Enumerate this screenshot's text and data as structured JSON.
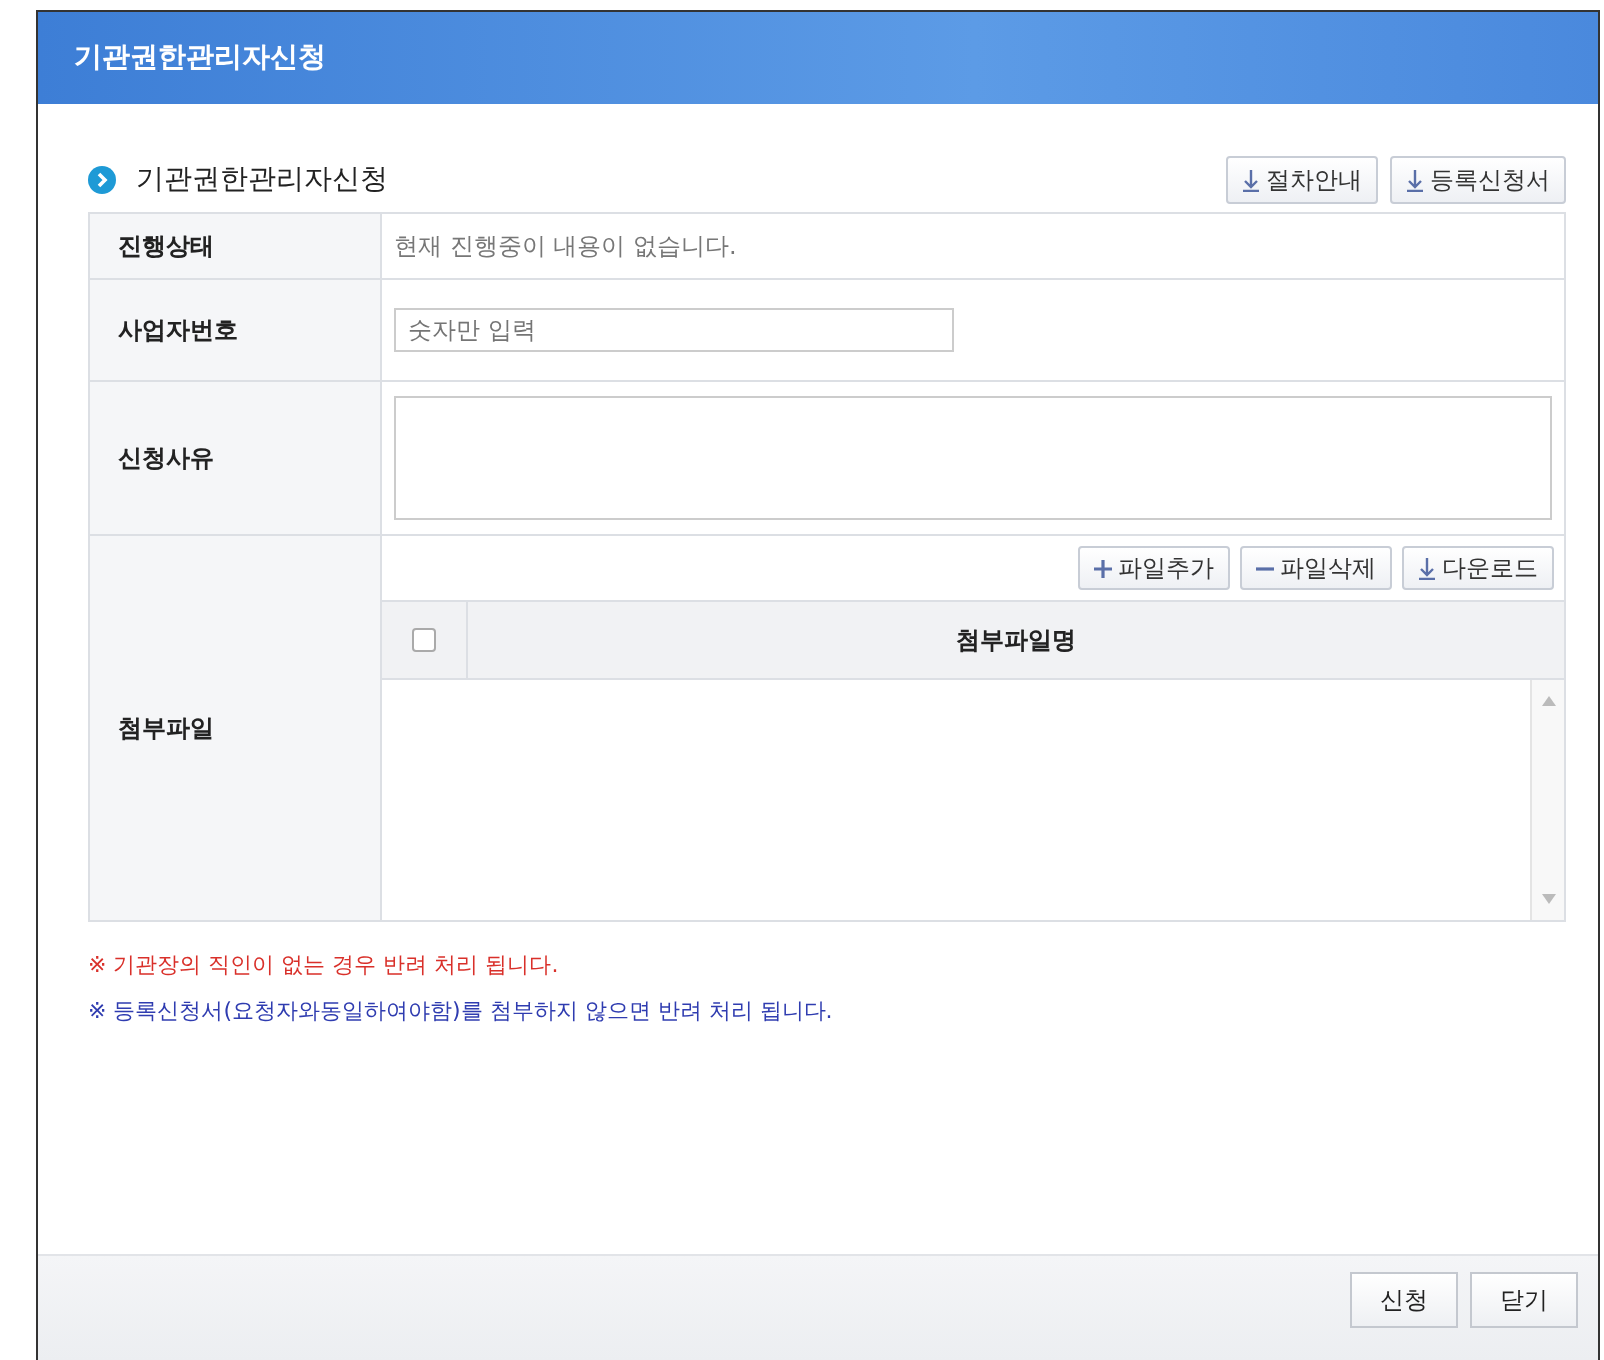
{
  "window": {
    "title": "기관권한관리자신청"
  },
  "section": {
    "title": "기관권한관리자신청",
    "buttons": [
      {
        "label": "절차안내",
        "kind": "download"
      },
      {
        "label": "등록신청서",
        "kind": "download"
      }
    ]
  },
  "form": {
    "status": {
      "label": "진행상태",
      "value": "현재 진행중이 내용이 없습니다."
    },
    "business_number": {
      "label": "사업자번호",
      "placeholder": "숫자만 입력"
    },
    "reason": {
      "label": "신청사유"
    },
    "attachments": {
      "label": "첨부파일",
      "buttons": [
        {
          "label": "파일추가",
          "kind": "add"
        },
        {
          "label": "파일삭제",
          "kind": "remove"
        },
        {
          "label": "다운로드",
          "kind": "download"
        }
      ],
      "select_all_checked": false,
      "column": "첨부파일명"
    }
  },
  "notes": [
    {
      "text": "※ 기관장의 직인이 없는 경우 반려 처리 됩니다.",
      "color": "#d9302a"
    },
    {
      "text": "※ 등록신청서(요청자와동일하여야함)를 첨부하지 않으면 반려 처리 됩니다.",
      "color": "#2f3cb0"
    }
  ],
  "footer_buttons": [
    "신청",
    "닫기"
  ]
}
